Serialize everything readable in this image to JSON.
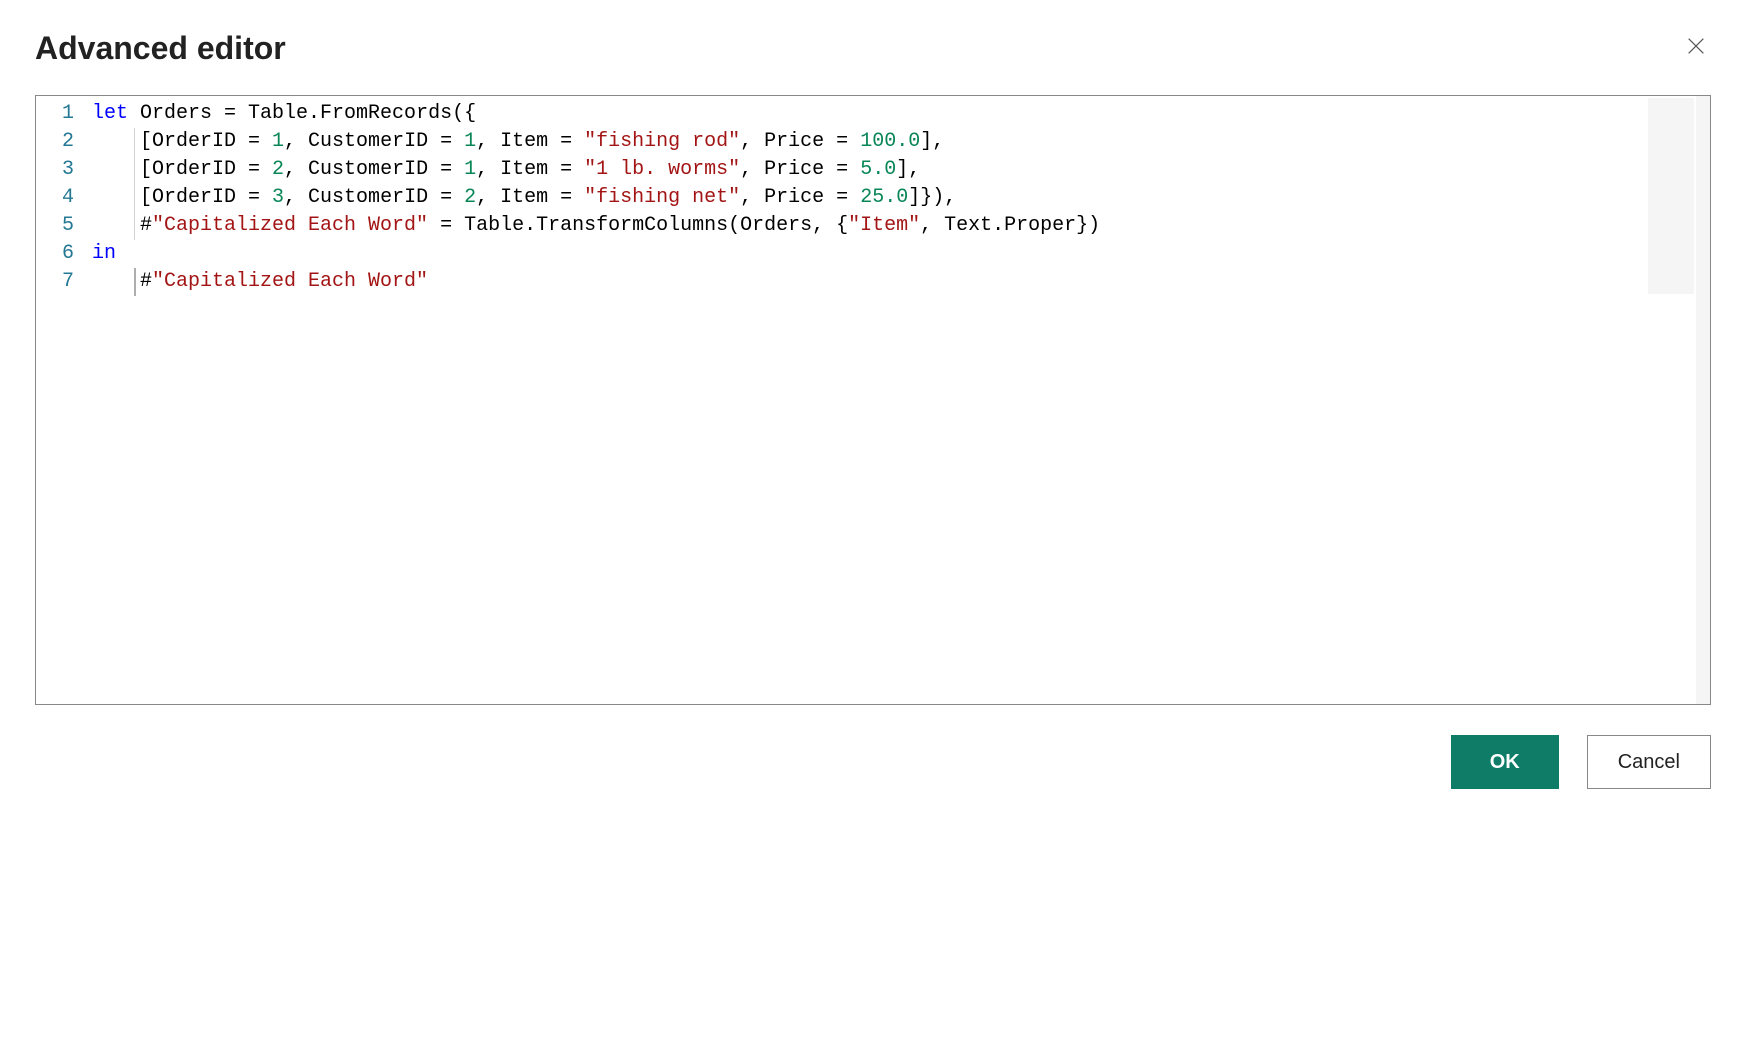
{
  "header": {
    "title": "Advanced editor"
  },
  "editor": {
    "lineNumbers": [
      "1",
      "2",
      "3",
      "4",
      "5",
      "6",
      "7"
    ],
    "lines": [
      {
        "indentGuide": false,
        "tokens": [
          {
            "cls": "tk-kw",
            "t": "let"
          },
          {
            "cls": "tk-id",
            "t": " Orders = Table.FromRecords({"
          }
        ]
      },
      {
        "indentGuide": true,
        "tokens": [
          {
            "cls": "tk-id",
            "t": "    [OrderID = "
          },
          {
            "cls": "tk-num",
            "t": "1"
          },
          {
            "cls": "tk-id",
            "t": ", CustomerID = "
          },
          {
            "cls": "tk-num",
            "t": "1"
          },
          {
            "cls": "tk-id",
            "t": ", Item = "
          },
          {
            "cls": "tk-str",
            "t": "\"fishing rod\""
          },
          {
            "cls": "tk-id",
            "t": ", Price = "
          },
          {
            "cls": "tk-num",
            "t": "100.0"
          },
          {
            "cls": "tk-id",
            "t": "],"
          }
        ]
      },
      {
        "indentGuide": true,
        "tokens": [
          {
            "cls": "tk-id",
            "t": "    [OrderID = "
          },
          {
            "cls": "tk-num",
            "t": "2"
          },
          {
            "cls": "tk-id",
            "t": ", CustomerID = "
          },
          {
            "cls": "tk-num",
            "t": "1"
          },
          {
            "cls": "tk-id",
            "t": ", Item = "
          },
          {
            "cls": "tk-str",
            "t": "\"1 lb. worms\""
          },
          {
            "cls": "tk-id",
            "t": ", Price = "
          },
          {
            "cls": "tk-num",
            "t": "5.0"
          },
          {
            "cls": "tk-id",
            "t": "],"
          }
        ]
      },
      {
        "indentGuide": true,
        "tokens": [
          {
            "cls": "tk-id",
            "t": "    [OrderID = "
          },
          {
            "cls": "tk-num",
            "t": "3"
          },
          {
            "cls": "tk-id",
            "t": ", CustomerID = "
          },
          {
            "cls": "tk-num",
            "t": "2"
          },
          {
            "cls": "tk-id",
            "t": ", Item = "
          },
          {
            "cls": "tk-str",
            "t": "\"fishing net\""
          },
          {
            "cls": "tk-id",
            "t": ", Price = "
          },
          {
            "cls": "tk-num",
            "t": "25.0"
          },
          {
            "cls": "tk-id",
            "t": "]}),"
          }
        ]
      },
      {
        "indentGuide": true,
        "tokens": [
          {
            "cls": "tk-id",
            "t": "    #"
          },
          {
            "cls": "tk-str",
            "t": "\"Capitalized Each Word\""
          },
          {
            "cls": "tk-id",
            "t": " = Table.TransformColumns(Orders, {"
          },
          {
            "cls": "tk-str",
            "t": "\"Item\""
          },
          {
            "cls": "tk-id",
            "t": ", Text.Proper})"
          }
        ]
      },
      {
        "indentGuide": false,
        "tokens": [
          {
            "cls": "tk-kw",
            "t": "in"
          }
        ]
      },
      {
        "indentGuide": false,
        "cursor": true,
        "tokens": [
          {
            "cls": "tk-id",
            "t": "    #"
          },
          {
            "cls": "tk-str",
            "t": "\"Capitalized Each Word\""
          }
        ]
      }
    ]
  },
  "buttons": {
    "ok": "OK",
    "cancel": "Cancel"
  }
}
